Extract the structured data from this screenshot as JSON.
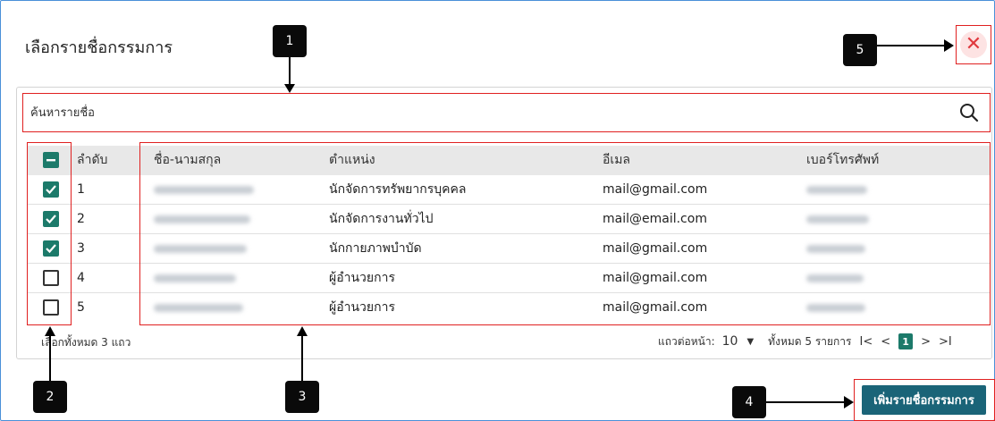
{
  "dialog": {
    "title": "เลือกรายชื่อกรรมการ",
    "close_label": "✕"
  },
  "search": {
    "placeholder": "ค้นหารายชื่อ",
    "value": ""
  },
  "table": {
    "headers": {
      "index": "ลำดับ",
      "name": "ชื่อ-นามสกุล",
      "position": "ตำแหน่ง",
      "email": "อีเมล",
      "phone": "เบอร์โทรศัพท์"
    },
    "rows": [
      {
        "index": "1",
        "position": "นักจัดการทรัพยากรบุคคล",
        "email": "mail@gmail.com",
        "checked": true
      },
      {
        "index": "2",
        "position": "นักจัดการงานทั่วไป",
        "email": "mail@email.com",
        "checked": true
      },
      {
        "index": "3",
        "position": "นักกายภาพบำบัด",
        "email": "mail@gmail.com",
        "checked": true
      },
      {
        "index": "4",
        "position": "ผู้อำนวยการ",
        "email": "mail@gmail.com",
        "checked": false
      },
      {
        "index": "5",
        "position": "ผู้อำนวยการ",
        "email": "mail@gmail.com",
        "checked": false
      }
    ]
  },
  "footer": {
    "selected_text": "เลือกทั้งหมด 3 แถว",
    "rows_per_page_label": "แถวต่อหน้า:",
    "rows_per_page_value": "10",
    "total_text": "ทั้งหมด 5 รายการ",
    "first": "I<",
    "prev": "<",
    "current_page": "1",
    "next": ">",
    "last": ">I"
  },
  "add_button": {
    "label": "เพิ่มรายชื่อกรรมการ"
  },
  "callouts": {
    "c1": "1",
    "c2": "2",
    "c3": "3",
    "c4": "4",
    "c5": "5"
  },
  "colors": {
    "accent": "#1c7a6a",
    "button": "#1a6478",
    "highlight": "#e02020"
  }
}
